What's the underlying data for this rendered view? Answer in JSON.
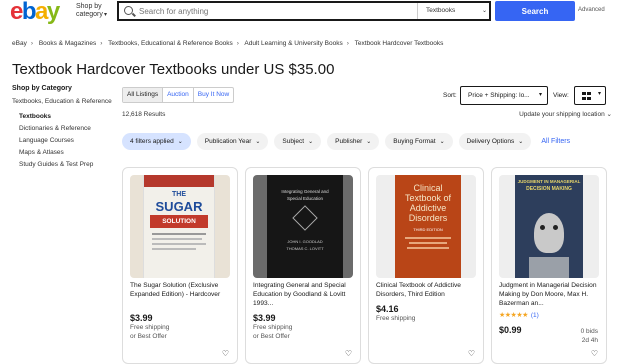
{
  "header": {
    "logo": [
      "e",
      "b",
      "a",
      "y"
    ],
    "shop_by": "Shop by",
    "category": "category",
    "search_placeholder": "Search for anything",
    "search_category": "Textbooks",
    "search_button": "Search",
    "advanced": "Advanced"
  },
  "breadcrumb": [
    "eBay",
    "Books & Magazines",
    "Textbooks, Educational & Reference Books",
    "Adult Learning & University Books",
    "Textbook Hardcover Textbooks"
  ],
  "page_title": "Textbook Hardcover Textbooks under US $35.00",
  "sidebar": {
    "title": "Shop by Category",
    "parent": "Textbooks, Education & Reference",
    "items": [
      "Textbooks",
      "Dictionaries & Reference",
      "Language Courses",
      "Maps & Atlases",
      "Study Guides & Test Prep"
    ]
  },
  "listing_tabs": [
    "All Listings",
    "Auction",
    "Buy It Now"
  ],
  "sort": {
    "label": "Sort:",
    "value": "Price + Shipping: lo..."
  },
  "view": {
    "label": "View:"
  },
  "results": "12,618 Results",
  "shipping_location": "Update your shipping location",
  "filters": [
    "4 filters applied",
    "Publication Year",
    "Subject",
    "Publisher",
    "Buying Format",
    "Delivery Options"
  ],
  "all_filters": "All Filters",
  "products": [
    {
      "title": "The Sugar Solution (Exclusive Expanded Edition) - Hardcover",
      "price": "$3.99",
      "line1": "Free shipping",
      "line2": "or Best Offer"
    },
    {
      "title": "Integrating General and Special Education by Goodland & Lovitt 1993...",
      "price": "$3.99",
      "line1": "Free shipping",
      "line2": "or Best Offer"
    },
    {
      "title": "Clinical Textbook of Addictive Disorders, Third Edition",
      "price": "$4.16",
      "line1": "Free shipping",
      "line2": ""
    },
    {
      "title": "Judgment in Managerial Decision Making by Don Moore, Max H. Bazerman an...",
      "price": "$0.99",
      "stars": "★★★★★",
      "rating_count": "(1)",
      "bids": "0 bids",
      "time_left": "2d 4h"
    }
  ],
  "book_covers": {
    "sugar": {
      "line1": "THE",
      "line2": "SUGAR",
      "line3": "SOLUTION"
    },
    "integrating": {
      "line1": "Integrating General and",
      "line2": "Special Education",
      "author": "JOHN I. GOODLAD",
      "author2": "THOMAS C. LOVITT"
    },
    "clinical": {
      "line1": "Clinical",
      "line2": "Textbook of",
      "line3": "Addictive",
      "line4": "Disorders",
      "edition": "THIRD EDITION"
    },
    "judgment": {
      "line1": "JUDGMENT IN MANAGERIAL",
      "line2": "DECISION MAKING"
    }
  },
  "colors": {
    "primary": "#3665f3",
    "chip_active": "#d6e3ff",
    "star": "#f5a623"
  }
}
